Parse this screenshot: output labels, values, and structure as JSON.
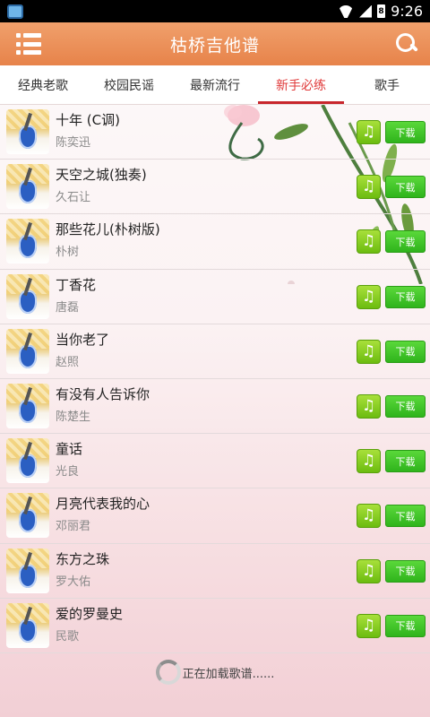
{
  "status_bar": {
    "time": "9:26",
    "battery_level": "8",
    "icons": [
      "notification-icon",
      "wifi-icon",
      "signal-icon",
      "battery-icon"
    ]
  },
  "header": {
    "title": "枯桥吉他谱",
    "menu_icon": "menu-list-icon",
    "search_icon": "search-icon",
    "color": "#e98a52"
  },
  "tabs": [
    {
      "label": "经典老歌",
      "active": false
    },
    {
      "label": "校园民谣",
      "active": false
    },
    {
      "label": "最新流行",
      "active": false
    },
    {
      "label": "新手必练",
      "active": true
    },
    {
      "label": "歌手",
      "active": false
    }
  ],
  "songs": [
    {
      "title": "十年 (C调)",
      "artist": "陈奕迅"
    },
    {
      "title": "天空之城(独奏)",
      "artist": "久石让"
    },
    {
      "title": "那些花儿(朴树版)",
      "artist": "朴树"
    },
    {
      "title": "丁香花",
      "artist": "唐磊"
    },
    {
      "title": "当你老了",
      "artist": "赵照"
    },
    {
      "title": "有没有人告诉你",
      "artist": "陈楚生"
    },
    {
      "title": "童话",
      "artist": "光良"
    },
    {
      "title": "月亮代表我的心",
      "artist": "邓丽君"
    },
    {
      "title": "东方之珠",
      "artist": "罗大佑"
    },
    {
      "title": "爱的罗曼史",
      "artist": "民歌"
    }
  ],
  "row_actions": {
    "play_icon": "music-note-icon",
    "download_label": "下载"
  },
  "footer": {
    "loading_text": "正在加载歌谱......"
  },
  "colors": {
    "accent_tab": "#c8262c",
    "button_green": "#2fb41c"
  }
}
